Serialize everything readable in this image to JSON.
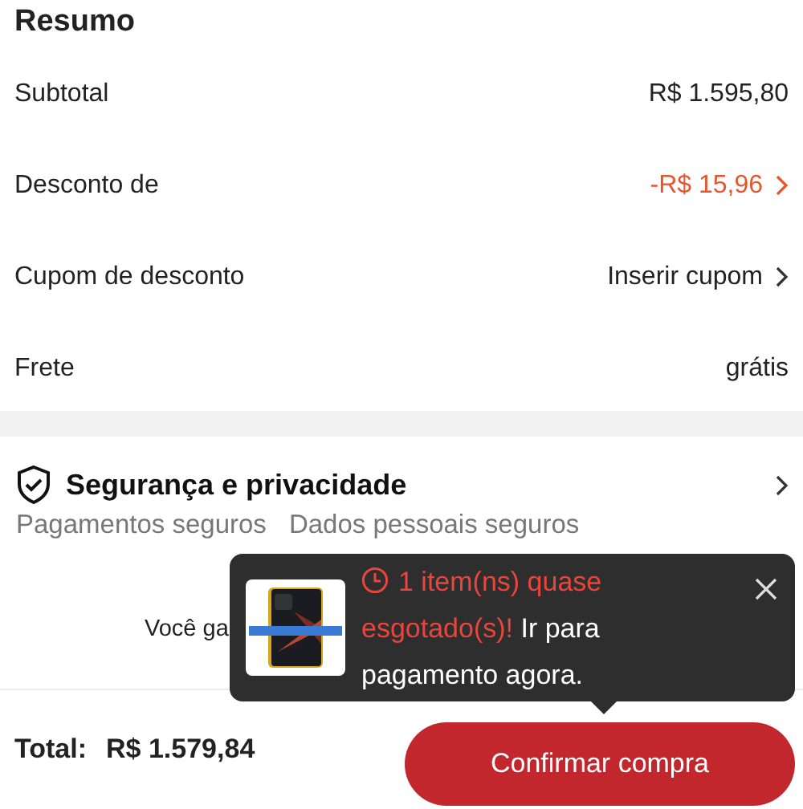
{
  "summary": {
    "title": "Resumo",
    "rows": [
      {
        "label": "Subtotal",
        "value": "R$ 1.595,80",
        "kind": "plain"
      },
      {
        "label": "Desconto de",
        "value": "-R$ 15,96",
        "kind": "discount"
      },
      {
        "label": "Cupom de desconto",
        "value": "Inserir cupom",
        "kind": "link"
      },
      {
        "label": "Frete",
        "value": "grátis",
        "kind": "plain"
      }
    ]
  },
  "security": {
    "title": "Segurança e privacidade",
    "items": [
      "Pagamentos seguros",
      "Dados pessoais seguros"
    ]
  },
  "credits": [
    "Você ga"
  ],
  "toast": {
    "alert": "1 item(ns) quase esgotado(s)!",
    "message": "Ir para pagamento agora."
  },
  "footer": {
    "total_label": "Total:",
    "total": "R$ 1.579,84",
    "button": "Confirmar compra"
  }
}
